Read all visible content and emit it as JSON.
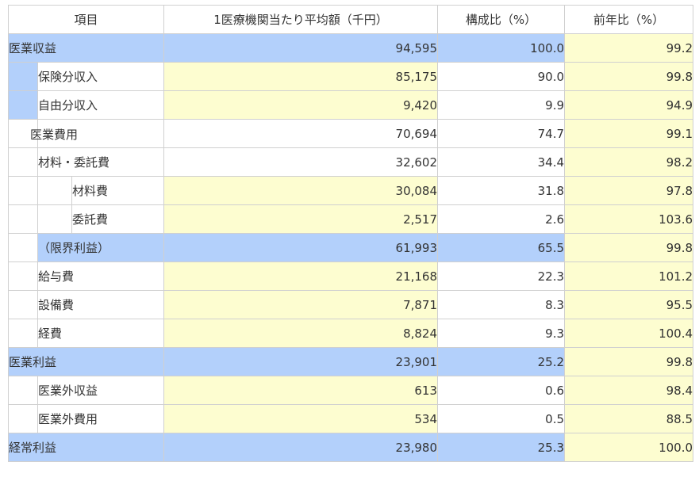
{
  "headers": [
    "項目",
    "1医療機関当たり平均額（千円）",
    "構成比（%）",
    "前年比（%）"
  ],
  "rows": [
    {
      "label": "医業収益",
      "amount": "94,595",
      "ratio": "100.0",
      "yoy": "99.2"
    },
    {
      "label": "保険分収入",
      "amount": "85,175",
      "ratio": "90.0",
      "yoy": "99.8"
    },
    {
      "label": "自由分収入",
      "amount": "9,420",
      "ratio": "9.9",
      "yoy": "94.9"
    },
    {
      "label": "医業費用",
      "amount": "70,694",
      "ratio": "74.7",
      "yoy": "99.1"
    },
    {
      "label": "材料・委託費",
      "amount": "32,602",
      "ratio": "34.4",
      "yoy": "98.2"
    },
    {
      "label": "材料費",
      "amount": "30,084",
      "ratio": "31.8",
      "yoy": "97.8"
    },
    {
      "label": "委託費",
      "amount": "2,517",
      "ratio": "2.6",
      "yoy": "103.6"
    },
    {
      "label": "（限界利益）",
      "amount": "61,993",
      "ratio": "65.5",
      "yoy": "99.8"
    },
    {
      "label": "給与費",
      "amount": "21,168",
      "ratio": "22.3",
      "yoy": "101.2"
    },
    {
      "label": "設備費",
      "amount": "7,871",
      "ratio": "8.3",
      "yoy": "95.5"
    },
    {
      "label": "経費",
      "amount": "8,824",
      "ratio": "9.3",
      "yoy": "100.4"
    },
    {
      "label": "医業利益",
      "amount": "23,901",
      "ratio": "25.2",
      "yoy": "99.8"
    },
    {
      "label": "医業外収益",
      "amount": "613",
      "ratio": "0.6",
      "yoy": "98.4"
    },
    {
      "label": "医業外費用",
      "amount": "534",
      "ratio": "0.5",
      "yoy": "88.5"
    },
    {
      "label": "経常利益",
      "amount": "23,980",
      "ratio": "25.3",
      "yoy": "100.0"
    }
  ],
  "colors": {
    "blue": "#b3d0fb",
    "yellow": "#fdfdd0",
    "border": "#d0d0d0",
    "text": "#333333"
  }
}
